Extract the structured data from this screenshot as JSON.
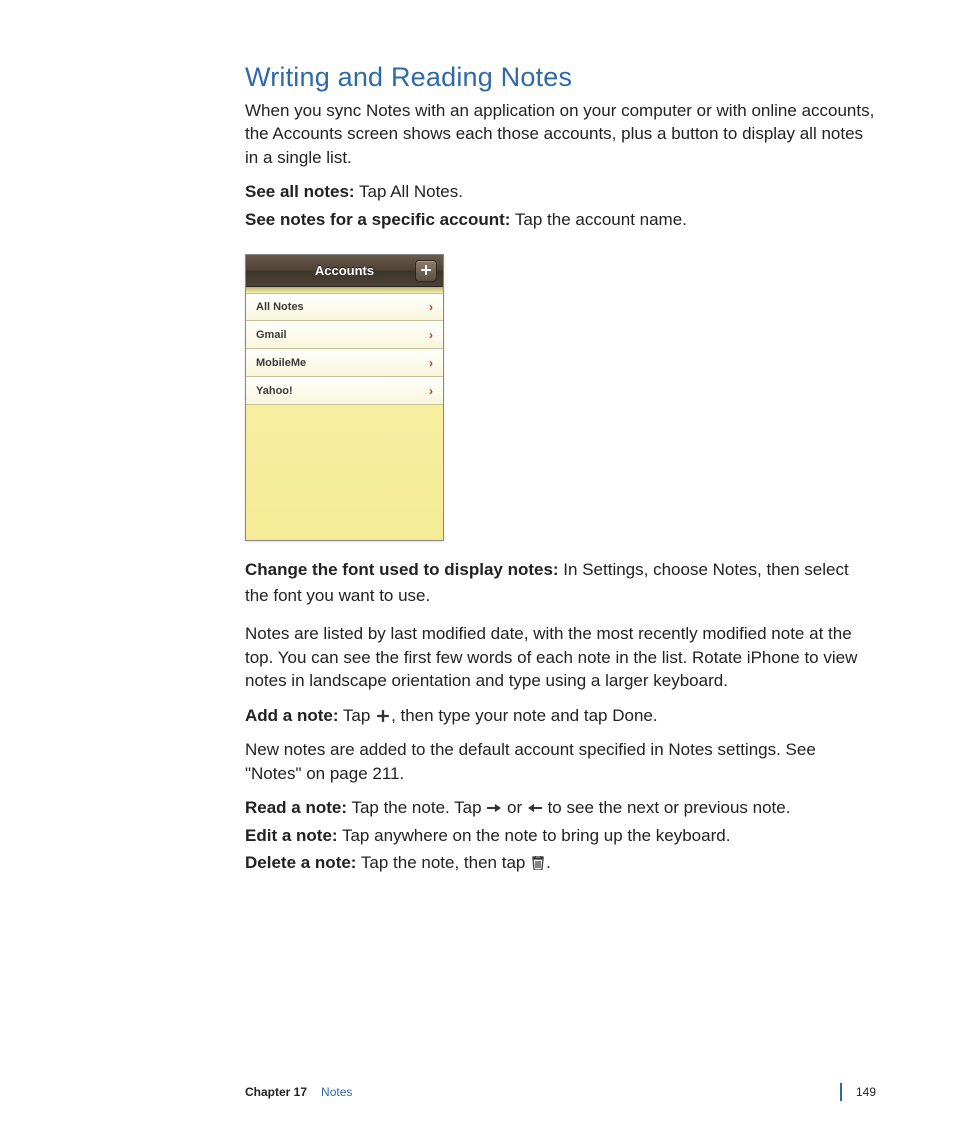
{
  "heading": "Writing and Reading Notes",
  "intro": "When you sync Notes with an application on your computer or with online accounts, the Accounts screen shows each those accounts, plus a button to display all notes in a single list.",
  "see_all_label": "See all notes:",
  "see_all_text": "  Tap All Notes.",
  "see_account_label": "See notes for a specific account:",
  "see_account_text": "  Tap the account name.",
  "screenshot": {
    "navbar_title": "Accounts",
    "rows": [
      "All Notes",
      "Gmail",
      "MobileMe",
      "Yahoo!"
    ]
  },
  "change_font_label": "Change the font used to display notes:",
  "change_font_text": "  In Settings, choose Notes, then select the font you want to use.",
  "listing_para": "Notes are listed by last modified date, with the most recently modified note at the top. You can see the first few words of each note in the list. Rotate iPhone to view notes in landscape orientation and type using a larger keyboard.",
  "add_note_label": "Add a note:",
  "add_note_pre": "  Tap ",
  "add_note_post": ", then type your note and tap Done.",
  "default_account": "New notes are added to the default account specified in Notes settings. See \"Notes\" on page 211.",
  "read_label": "Read a note:",
  "read_pre": "  Tap the note. Tap ",
  "read_mid": " or ",
  "read_post": " to see the next or previous note.",
  "edit_label": "Edit a note:",
  "edit_text": "  Tap anywhere on the note to bring up the keyboard.",
  "delete_label": "Delete a note:",
  "delete_pre": "  Tap the note, then tap ",
  "delete_post": ".",
  "footer": {
    "chapter_label": "Chapter 17",
    "chapter_name": "Notes",
    "page": "149"
  }
}
